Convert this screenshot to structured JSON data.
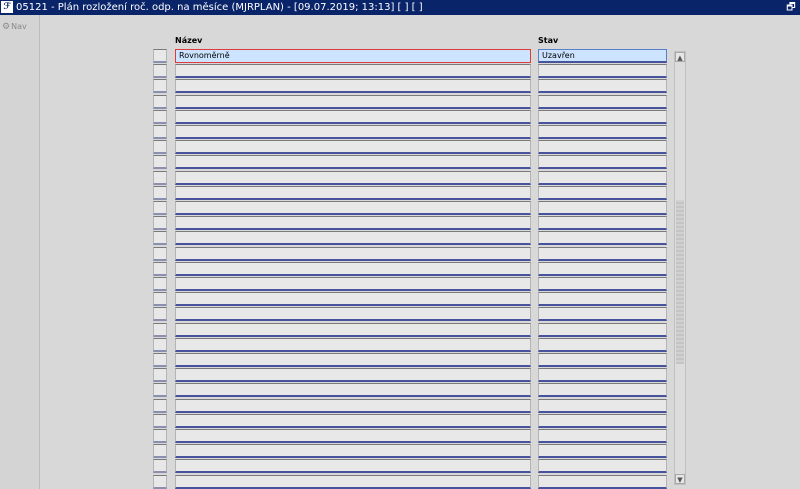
{
  "window": {
    "title": "05121 - Plán rozložení roč. odp. na měsíce (MJRPLAN) - [09.07.2019; 13:13]  [ ]  [ ]",
    "icon": "app-icon"
  },
  "nav": {
    "label": "Nav"
  },
  "columns": {
    "nazev": "Název",
    "stav": "Stav"
  },
  "rows": [
    {
      "nazev": "Rovnoměrně",
      "stav": "Uzavřen"
    },
    {
      "nazev": "",
      "stav": ""
    },
    {
      "nazev": "",
      "stav": ""
    },
    {
      "nazev": "",
      "stav": ""
    },
    {
      "nazev": "",
      "stav": ""
    },
    {
      "nazev": "",
      "stav": ""
    },
    {
      "nazev": "",
      "stav": ""
    },
    {
      "nazev": "",
      "stav": ""
    },
    {
      "nazev": "",
      "stav": ""
    },
    {
      "nazev": "",
      "stav": ""
    },
    {
      "nazev": "",
      "stav": ""
    },
    {
      "nazev": "",
      "stav": ""
    },
    {
      "nazev": "",
      "stav": ""
    },
    {
      "nazev": "",
      "stav": ""
    },
    {
      "nazev": "",
      "stav": ""
    },
    {
      "nazev": "",
      "stav": ""
    },
    {
      "nazev": "",
      "stav": ""
    },
    {
      "nazev": "",
      "stav": ""
    },
    {
      "nazev": "",
      "stav": ""
    },
    {
      "nazev": "",
      "stav": ""
    },
    {
      "nazev": "",
      "stav": ""
    },
    {
      "nazev": "",
      "stav": ""
    },
    {
      "nazev": "",
      "stav": ""
    },
    {
      "nazev": "",
      "stav": ""
    },
    {
      "nazev": "",
      "stav": ""
    },
    {
      "nazev": "",
      "stav": ""
    },
    {
      "nazev": "",
      "stav": ""
    },
    {
      "nazev": "",
      "stav": ""
    },
    {
      "nazev": "",
      "stav": ""
    }
  ]
}
